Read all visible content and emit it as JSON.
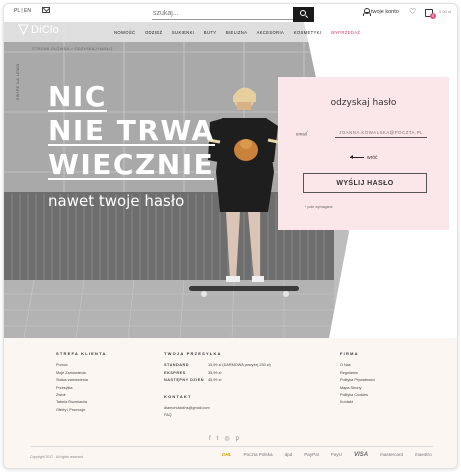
{
  "topbar": {
    "lang": "PL | EN",
    "search_placeholder": "szukaj...",
    "account_label": "twoje konto",
    "cart_count": "0",
    "cart_value": "0,00 zł"
  },
  "header": {
    "logo": "DiClo",
    "nav": [
      {
        "label": "NOWOŚĆ"
      },
      {
        "label": "ODZIEŻ"
      },
      {
        "label": "SUKIENKI"
      },
      {
        "label": "BUTY"
      },
      {
        "label": "BIELIZNA"
      },
      {
        "label": "AKCESORIA"
      },
      {
        "label": "KOSMETYKI"
      },
      {
        "label": "WYPRZEDAŻ"
      }
    ],
    "breadcrumb": "STRONA GŁÓWNA  >  ODZYSKAJ HASŁO",
    "scroll_label": "SWIPE NA LEWO"
  },
  "hero": {
    "line1": "NIC",
    "line2": "NIE TRWA",
    "line3": "WIECZNIE",
    "subhead": "nawet twoje hasło"
  },
  "recover_form": {
    "title": "odzyskaj hasło",
    "email_label": "email",
    "email_placeholder": "JOANNA.KOWALSKA@POCZTA.PL",
    "back_label": "wróć",
    "submit_label": "WYŚLIJ HASŁO",
    "required_note": "* pole wymagane"
  },
  "footer": {
    "client_zone": {
      "heading": "STREFA KLIENTA",
      "links": [
        "Pomoc",
        "Moje Zamówienia",
        "Status zamówienia",
        "Przesyłka",
        "Zwrot",
        "Tabela Rozmiarów",
        "Oferty i Promocje"
      ]
    },
    "shipping": {
      "heading": "TWOJA PRZESYŁKA",
      "rows": [
        {
          "name": "STANDARD",
          "price": "15,99 zł (DARMOWA powyżej 250 zł)"
        },
        {
          "name": "EKSPRES",
          "price": "35,99 zł"
        },
        {
          "name": "NASTĘPNY DZIEŃ",
          "price": "45,99 zł"
        }
      ]
    },
    "contact": {
      "heading": "KONTAKT",
      "email": "diamondcloths@gmail.com",
      "faq": "FAQ"
    },
    "company": {
      "heading": "FIRMA",
      "links": [
        "O Nas",
        "Regulamin",
        "Polityka Prywatności",
        "Mapa Strony",
        "Polityka Cookies",
        "Kontakt"
      ]
    },
    "social": [
      "f",
      "t",
      "◎",
      "p"
    ],
    "copyright": "Copyright 2017 - All rights reserved",
    "partners": [
      "DHL",
      "Poczta Polska",
      "dpd",
      "PayPal",
      "PayU",
      "VISA",
      "mastercard",
      "maestro"
    ]
  },
  "colors": {
    "accent": "#d9365f",
    "panel_bg": "#fbe7e9",
    "footer_bg": "#fcf6f3",
    "search_btn": "#1a1a1a"
  }
}
